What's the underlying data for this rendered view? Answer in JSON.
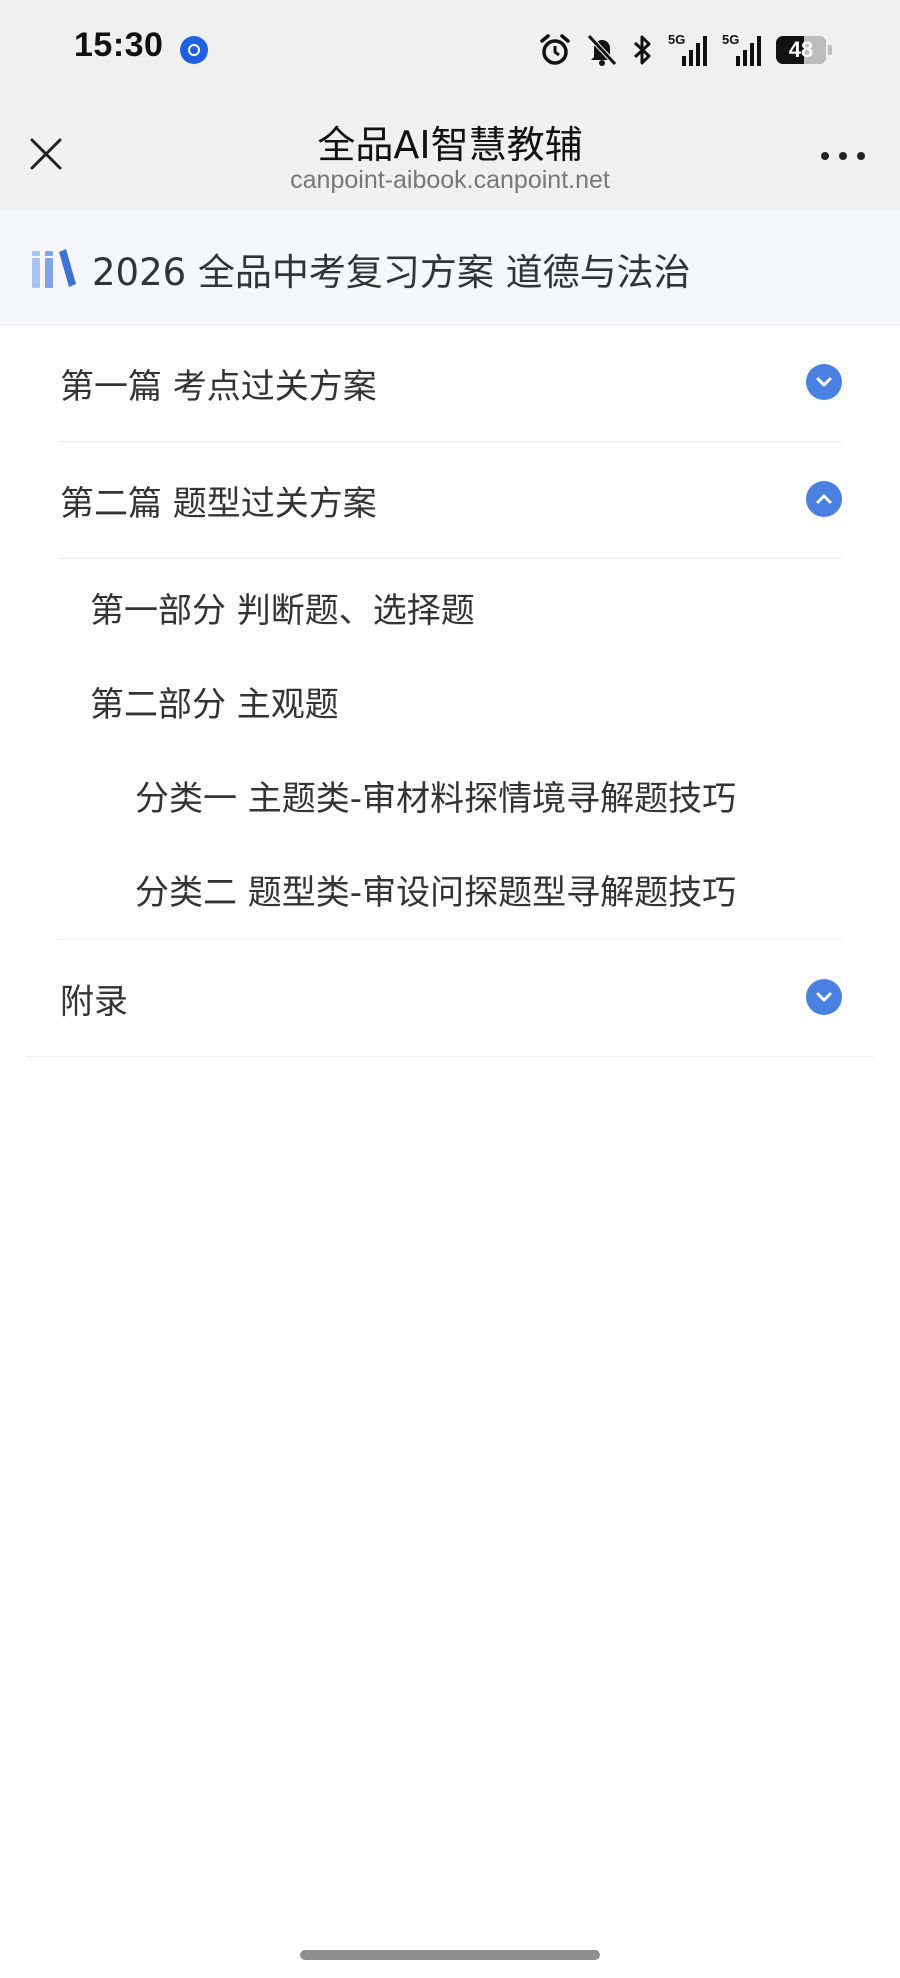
{
  "status_bar": {
    "time": "15:30",
    "network_1": "5G",
    "network_2": "5G",
    "battery": "48"
  },
  "nav": {
    "title": "全品AI智慧教辅",
    "subtitle": "canpoint-aibook.canpoint.net"
  },
  "book": {
    "title": "2026 全品中考复习方案 道德与法治"
  },
  "toc": {
    "sections": [
      {
        "label": "第一篇  考点过关方案",
        "expanded": false
      },
      {
        "label": "第二篇  题型过关方案",
        "expanded": true
      },
      {
        "label": "附录",
        "expanded": false
      }
    ],
    "children": [
      {
        "label": "第一部分 判断题、选择题",
        "level": 1
      },
      {
        "label": "第二部分 主观题",
        "level": 1
      },
      {
        "label": "分类一 主题类-审材料探情境寻解题技巧",
        "level": 2
      },
      {
        "label": "分类二 题型类-审设问探题型寻解题技巧",
        "level": 2
      }
    ]
  },
  "colors": {
    "accent": "#4a80e0",
    "bar_background": "#f0f0f0"
  }
}
